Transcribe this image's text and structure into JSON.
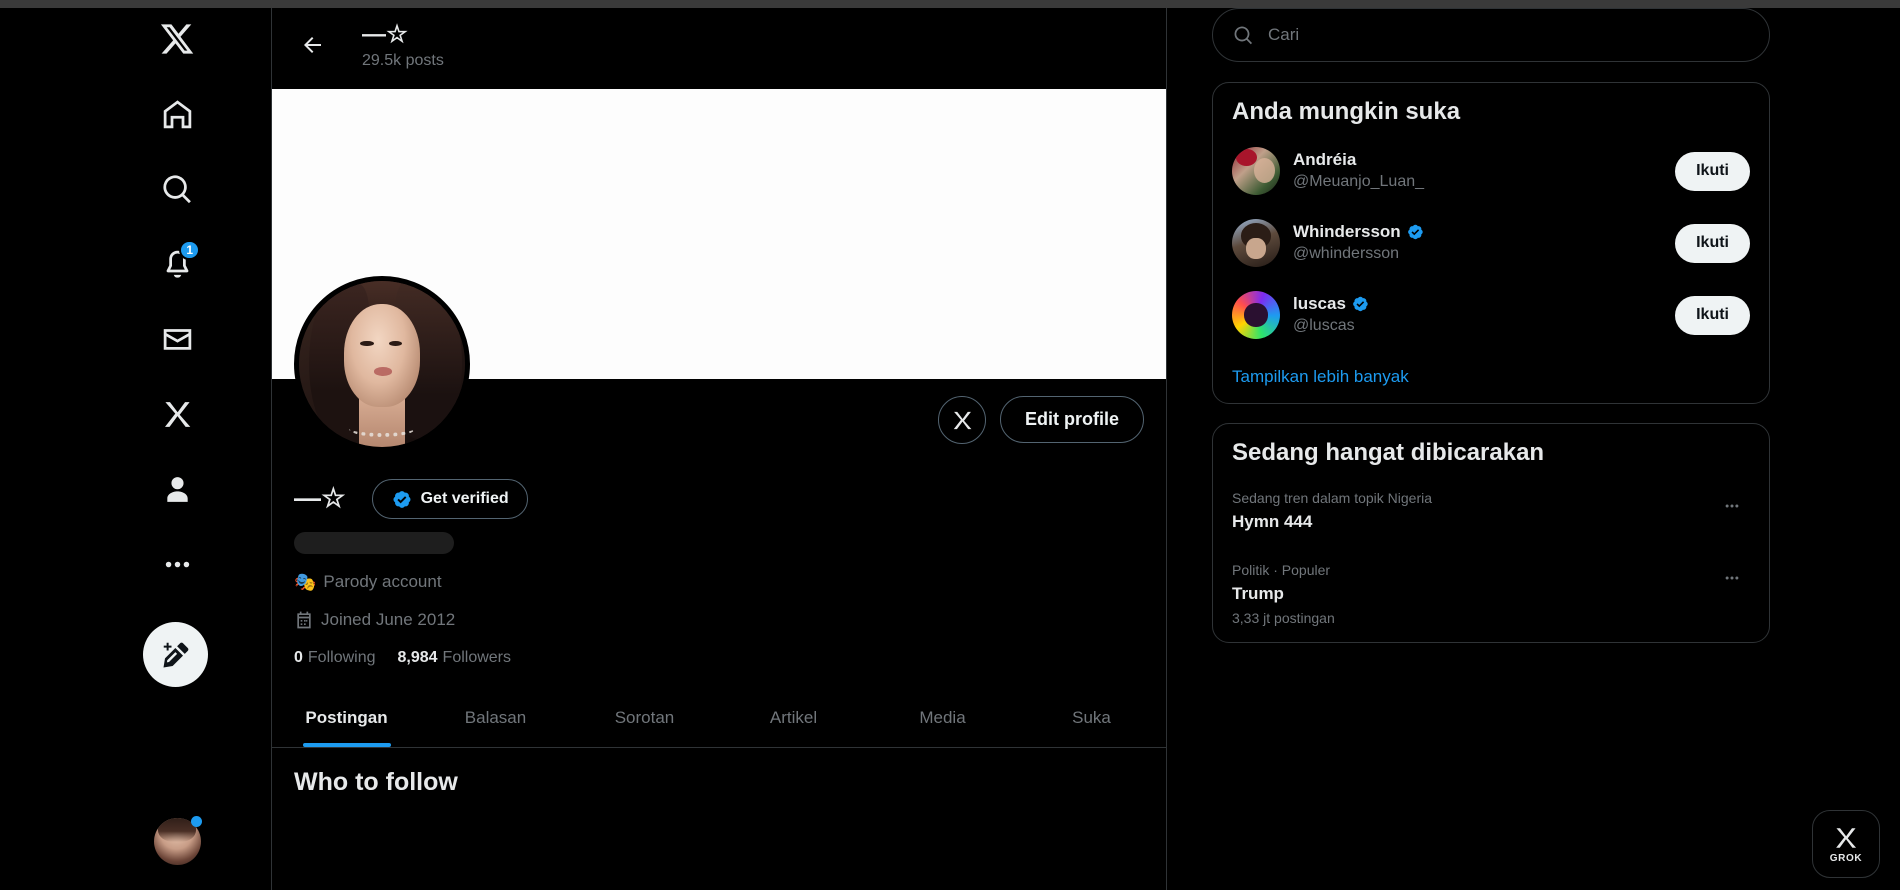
{
  "left_nav": {
    "items": [
      {
        "name": "x-logo",
        "icon": "x-logo-icon",
        "badge": null
      },
      {
        "name": "home",
        "icon": "home-icon",
        "badge": null
      },
      {
        "name": "explore",
        "icon": "search-icon",
        "badge": null
      },
      {
        "name": "notifications",
        "icon": "bell-icon",
        "badge": "1"
      },
      {
        "name": "messages",
        "icon": "envelope-icon",
        "badge": null
      },
      {
        "name": "grok",
        "icon": "grok-icon",
        "badge": null
      },
      {
        "name": "profile",
        "icon": "person-icon",
        "badge": null
      },
      {
        "name": "more",
        "icon": "more-horizontal-icon",
        "badge": null
      }
    ],
    "compose_icon": "compose-post-icon"
  },
  "profile_header": {
    "back_icon": "arrow-left-icon",
    "name": "—☆",
    "posts_count": "29.5k posts"
  },
  "profile": {
    "display_name": "—☆",
    "handle_placeholder": "",
    "grok_button_icon": "grok-icon",
    "edit_profile_label": "Edit profile",
    "get_verified_label": "Get verified",
    "verified_badge_icon": "verified-badge-icon",
    "parody_icon": "theater-masks-icon",
    "parody_label": "Parody account",
    "joined_icon": "calendar-icon",
    "joined_label": "Joined June 2012",
    "following_count": "0",
    "following_label": "Following",
    "followers_count": "8,984",
    "followers_label": "Followers"
  },
  "tabs": [
    {
      "label": "Postingan",
      "active": true
    },
    {
      "label": "Balasan",
      "active": false
    },
    {
      "label": "Sorotan",
      "active": false
    },
    {
      "label": "Artikel",
      "active": false
    },
    {
      "label": "Media",
      "active": false
    },
    {
      "label": "Suka",
      "active": false
    }
  ],
  "timeline": {
    "who_to_follow_title": "Who to follow"
  },
  "search": {
    "placeholder": "Cari",
    "value": "",
    "icon": "search-icon"
  },
  "suggestions_panel": {
    "title": "Anda mungkin suka",
    "items": [
      {
        "name": "Andréia",
        "handle": "@Meuanjo_Luan_",
        "verified": false,
        "follow_label": "Ikuti"
      },
      {
        "name": "Whindersson",
        "handle": "@whindersson",
        "verified": true,
        "follow_label": "Ikuti"
      },
      {
        "name": "luscas",
        "handle": "@luscas",
        "verified": true,
        "follow_label": "Ikuti"
      }
    ],
    "show_more_label": "Tampilkan lebih banyak"
  },
  "trends_panel": {
    "title": "Sedang hangat dibicarakan",
    "items": [
      {
        "category": "Sedang tren dalam topik Nigeria",
        "name": "Hymn 444",
        "count": ""
      },
      {
        "category": "Politik · Populer",
        "name": "Trump",
        "count": "3,33 jt postingan"
      }
    ],
    "more_icon": "more-horizontal-icon"
  },
  "grok_fab": {
    "icon": "grok-icon",
    "label": "GROK"
  },
  "colors": {
    "accent": "#1d9bf0",
    "background": "#000000",
    "border": "#2f3336",
    "text": "#e7e9ea",
    "muted": "#71767b"
  }
}
